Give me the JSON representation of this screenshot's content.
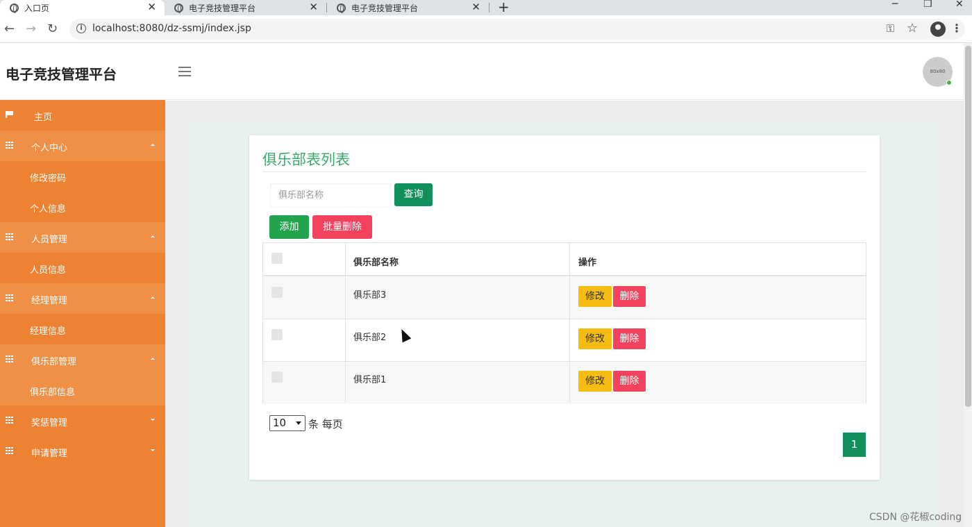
{
  "browser": {
    "tabs": [
      {
        "title": "入口页"
      },
      {
        "title": "电子竞技管理平台"
      },
      {
        "title": "电子竞技管理平台"
      }
    ],
    "new_tab": "+",
    "url": "localhost:8080/dz-ssmj/index.jsp"
  },
  "header": {
    "brand": "电子竞技管理平台",
    "avatar_text": "80x80"
  },
  "sidebar": {
    "home": "主页",
    "groups": [
      {
        "label": "个人中心",
        "expanded": true,
        "items": [
          "修改密码",
          "个人信息"
        ]
      },
      {
        "label": "人员管理",
        "expanded": true,
        "items": [
          "人员信息"
        ]
      },
      {
        "label": "经理管理",
        "expanded": true,
        "items": [
          "经理信息"
        ]
      },
      {
        "label": "俱乐部管理",
        "expanded": true,
        "items": [
          "俱乐部信息"
        ]
      },
      {
        "label": "奖惩管理",
        "expanded": false,
        "items": []
      },
      {
        "label": "申请管理",
        "expanded": false,
        "items": []
      }
    ]
  },
  "main": {
    "title": "俱乐部表列表",
    "search": {
      "placeholder": "俱乐部名称",
      "button": "查询"
    },
    "actions": {
      "add": "添加",
      "batch_delete": "批量删除"
    },
    "table": {
      "columns": [
        "俱乐部名称",
        "操作"
      ],
      "rows": [
        {
          "name": "俱乐部3"
        },
        {
          "name": "俱乐部2"
        },
        {
          "name": "俱乐部1"
        }
      ],
      "edit_label": "修改",
      "delete_label": "删除"
    },
    "pagination": {
      "page_size": "10",
      "per_page_label": "条 每页",
      "current_page": "1"
    }
  },
  "watermark": "CSDN @花椒coding",
  "colors": {
    "sidebar": "#ed8233",
    "accent": "#12905b",
    "danger": "#f2425e",
    "warning": "#f7bc12"
  }
}
